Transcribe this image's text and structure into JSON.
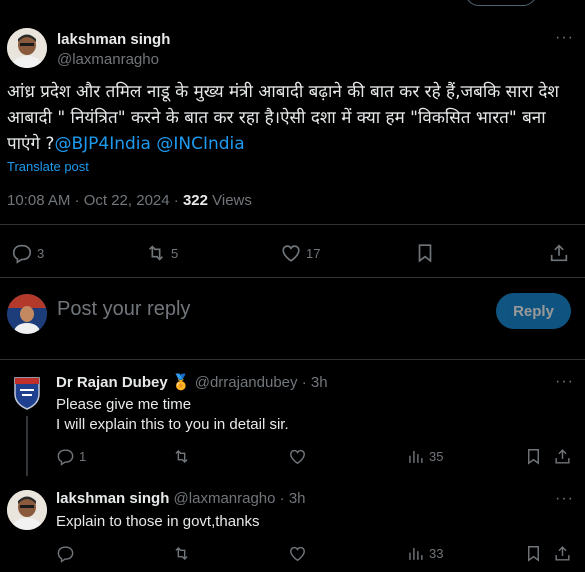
{
  "main_tweet": {
    "author_name": "lakshman singh",
    "author_handle": "@laxmanragho",
    "text_body": "आंध्र प्रदेश और तमिल नाडू के मुख्य मंत्री आबादी बढ़ाने की बात कर रहे हैं,जबकि सारा देश आबादी \" नियंत्रित\" करने के बात कर रहा है।ऐसी दशा में क्या हम \"विकसित भारत\" बना पाएंगे ?",
    "mention_1": "@BJP4India",
    "mention_2": "@INCIndia",
    "translate_label": "Translate post",
    "timestamp": "10:08 AM · Oct 22, 2024 · ",
    "views_count": "322",
    "views_label": " Views",
    "replies": "3",
    "reposts": "5",
    "likes": "17"
  },
  "composer": {
    "placeholder": "Post your reply",
    "reply_button": "Reply"
  },
  "replies": [
    {
      "author_name": "Dr Rajan Dubey",
      "verified_emoji": "🏅",
      "author_handle": "@drrajandubey",
      "time": "· 3h",
      "lines": [
        "Please give me time",
        "I will explain this to you in detail sir."
      ],
      "replies": "1",
      "views": "35"
    },
    {
      "author_name": "lakshman singh",
      "author_handle": "@laxmanragho",
      "time": "· 3h",
      "lines": [
        "Explain to those in govt,thanks"
      ],
      "views": "33"
    }
  ],
  "more_label": "···",
  "colors": {
    "accent": "#1d9bf0",
    "muted": "#71767b",
    "text": "#e7e9ea",
    "border": "#2f3336",
    "background": "#000000"
  },
  "icons": [
    "reply-icon",
    "repost-icon",
    "like-icon",
    "bookmark-icon",
    "share-icon",
    "views-icon",
    "more-icon"
  ]
}
